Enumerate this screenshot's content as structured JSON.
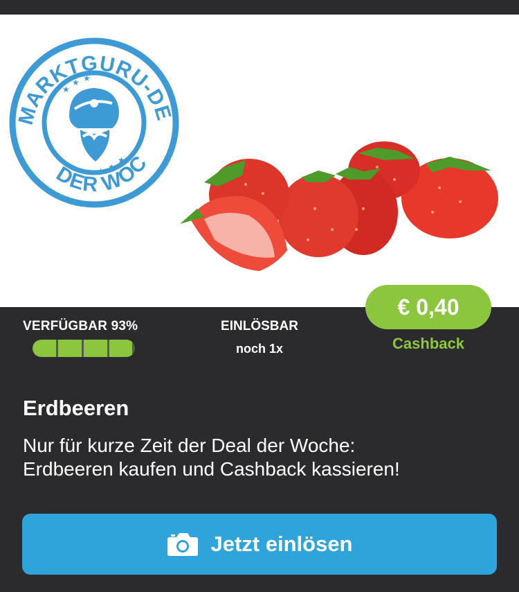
{
  "deal_badge": {
    "top_text": "MARKTGURU-DEAL",
    "bottom_text": "DER WOCHE"
  },
  "product_image": {
    "icon": "strawberries-image"
  },
  "stats": {
    "availability_label": "VERFÜGBAR 93%",
    "availability_percent": 93,
    "redeemable_label": "EINLÖSBAR",
    "redeemable_count": "noch 1x"
  },
  "cashback": {
    "amount": "€ 0,40",
    "label": "Cashback"
  },
  "product": {
    "title": "Erdbeeren",
    "description_line1": "Nur für kurze Zeit der Deal der Woche:",
    "description_line2": "Erdbeeren kaufen und Cashback kassieren!"
  },
  "cta": {
    "label": "Jetzt einlösen",
    "icon": "camera-icon"
  },
  "colors": {
    "background": "#2b2b2d",
    "accent_green": "#8cc63f",
    "button_blue": "#2ea4db",
    "badge_blue": "#3d9ad4"
  }
}
